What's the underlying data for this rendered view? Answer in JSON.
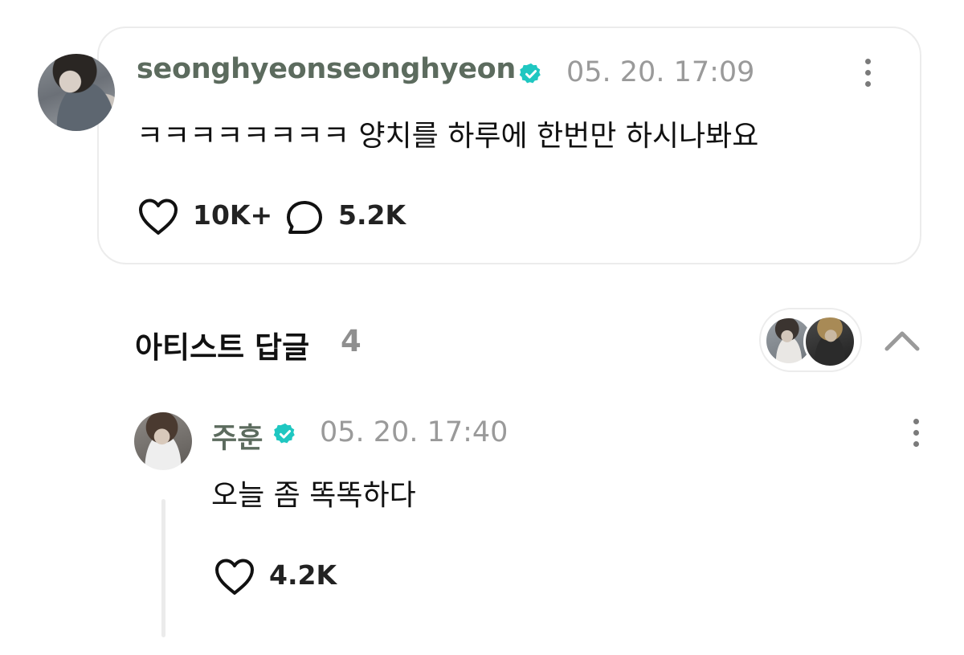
{
  "main_comment": {
    "username": "seonghyeonseonghyeon",
    "timestamp": "05. 20. 17:09",
    "text": "ㅋㅋㅋㅋㅋㅋㅋㅋ 양치를 하루에 한번만 하시나봐요",
    "likes": "10K+",
    "replies": "5.2K",
    "verified": true
  },
  "artist_replies": {
    "title": "아티스트 답글",
    "count": "4",
    "expanded": true
  },
  "reply": {
    "username": "주훈",
    "timestamp": "05. 20. 17:40",
    "text": "오늘 좀 똑똑하다",
    "likes": "4.2K",
    "verified": true
  },
  "icons": {
    "verified": "verified-badge-icon",
    "more": "more-vertical-icon",
    "like": "heart-outline-icon",
    "reply": "speech-bubble-icon",
    "collapse": "chevron-up-icon"
  },
  "colors": {
    "username": "#5c6b5e",
    "verified_badge": "#1fc7c1",
    "timestamp": "#9a9a9a",
    "count": "#8f8f8f",
    "border": "#ececec"
  }
}
